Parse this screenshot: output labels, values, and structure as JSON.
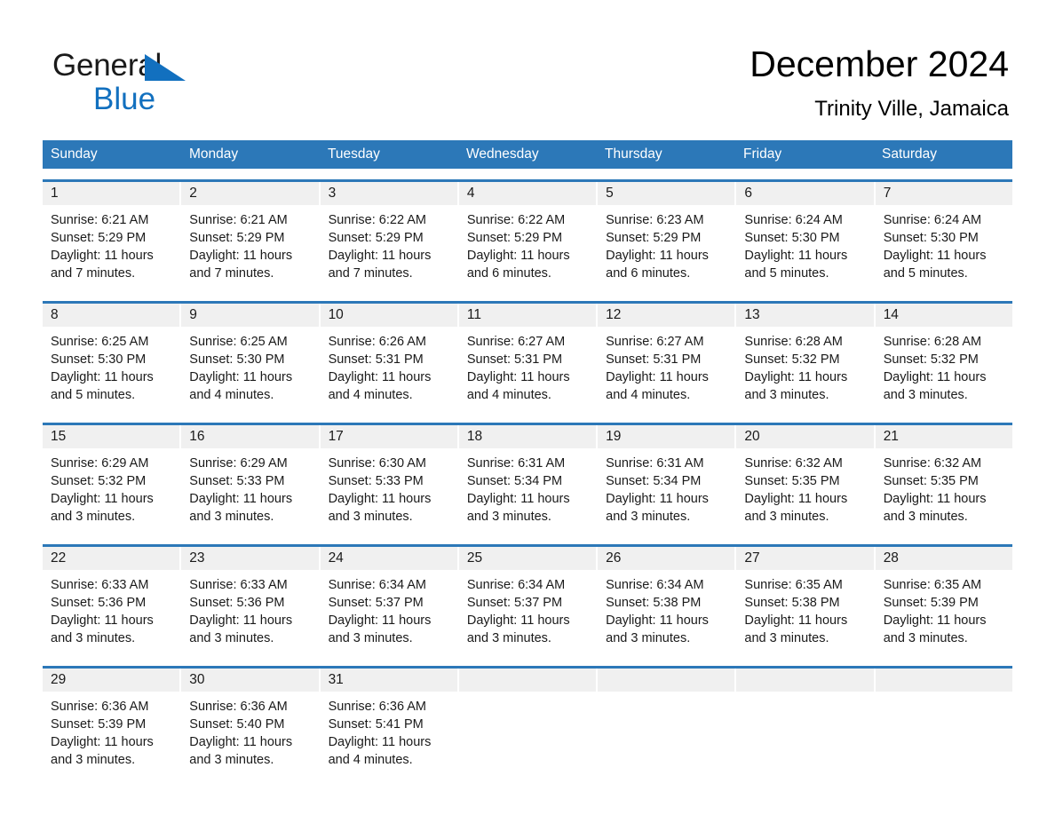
{
  "brand": {
    "name_part1": "General",
    "name_part2": "Blue",
    "flag_icon": "triangle-flag-icon",
    "accent_color": "#1270bf"
  },
  "header": {
    "title": "December 2024",
    "subtitle": "Trinity Ville, Jamaica"
  },
  "theme": {
    "header_blue": "#2c78b8",
    "day_band_gray": "#f0f0f0",
    "text_black": "#1a1a1a"
  },
  "weekdays": [
    "Sunday",
    "Monday",
    "Tuesday",
    "Wednesday",
    "Thursday",
    "Friday",
    "Saturday"
  ],
  "weeks": [
    [
      {
        "day": "1",
        "sunrise": "Sunrise: 6:21 AM",
        "sunset": "Sunset: 5:29 PM",
        "daylight": "Daylight: 11 hours and 7 minutes."
      },
      {
        "day": "2",
        "sunrise": "Sunrise: 6:21 AM",
        "sunset": "Sunset: 5:29 PM",
        "daylight": "Daylight: 11 hours and 7 minutes."
      },
      {
        "day": "3",
        "sunrise": "Sunrise: 6:22 AM",
        "sunset": "Sunset: 5:29 PM",
        "daylight": "Daylight: 11 hours and 7 minutes."
      },
      {
        "day": "4",
        "sunrise": "Sunrise: 6:22 AM",
        "sunset": "Sunset: 5:29 PM",
        "daylight": "Daylight: 11 hours and 6 minutes."
      },
      {
        "day": "5",
        "sunrise": "Sunrise: 6:23 AM",
        "sunset": "Sunset: 5:29 PM",
        "daylight": "Daylight: 11 hours and 6 minutes."
      },
      {
        "day": "6",
        "sunrise": "Sunrise: 6:24 AM",
        "sunset": "Sunset: 5:30 PM",
        "daylight": "Daylight: 11 hours and 5 minutes."
      },
      {
        "day": "7",
        "sunrise": "Sunrise: 6:24 AM",
        "sunset": "Sunset: 5:30 PM",
        "daylight": "Daylight: 11 hours and 5 minutes."
      }
    ],
    [
      {
        "day": "8",
        "sunrise": "Sunrise: 6:25 AM",
        "sunset": "Sunset: 5:30 PM",
        "daylight": "Daylight: 11 hours and 5 minutes."
      },
      {
        "day": "9",
        "sunrise": "Sunrise: 6:25 AM",
        "sunset": "Sunset: 5:30 PM",
        "daylight": "Daylight: 11 hours and 4 minutes."
      },
      {
        "day": "10",
        "sunrise": "Sunrise: 6:26 AM",
        "sunset": "Sunset: 5:31 PM",
        "daylight": "Daylight: 11 hours and 4 minutes."
      },
      {
        "day": "11",
        "sunrise": "Sunrise: 6:27 AM",
        "sunset": "Sunset: 5:31 PM",
        "daylight": "Daylight: 11 hours and 4 minutes."
      },
      {
        "day": "12",
        "sunrise": "Sunrise: 6:27 AM",
        "sunset": "Sunset: 5:31 PM",
        "daylight": "Daylight: 11 hours and 4 minutes."
      },
      {
        "day": "13",
        "sunrise": "Sunrise: 6:28 AM",
        "sunset": "Sunset: 5:32 PM",
        "daylight": "Daylight: 11 hours and 3 minutes."
      },
      {
        "day": "14",
        "sunrise": "Sunrise: 6:28 AM",
        "sunset": "Sunset: 5:32 PM",
        "daylight": "Daylight: 11 hours and 3 minutes."
      }
    ],
    [
      {
        "day": "15",
        "sunrise": "Sunrise: 6:29 AM",
        "sunset": "Sunset: 5:32 PM",
        "daylight": "Daylight: 11 hours and 3 minutes."
      },
      {
        "day": "16",
        "sunrise": "Sunrise: 6:29 AM",
        "sunset": "Sunset: 5:33 PM",
        "daylight": "Daylight: 11 hours and 3 minutes."
      },
      {
        "day": "17",
        "sunrise": "Sunrise: 6:30 AM",
        "sunset": "Sunset: 5:33 PM",
        "daylight": "Daylight: 11 hours and 3 minutes."
      },
      {
        "day": "18",
        "sunrise": "Sunrise: 6:31 AM",
        "sunset": "Sunset: 5:34 PM",
        "daylight": "Daylight: 11 hours and 3 minutes."
      },
      {
        "day": "19",
        "sunrise": "Sunrise: 6:31 AM",
        "sunset": "Sunset: 5:34 PM",
        "daylight": "Daylight: 11 hours and 3 minutes."
      },
      {
        "day": "20",
        "sunrise": "Sunrise: 6:32 AM",
        "sunset": "Sunset: 5:35 PM",
        "daylight": "Daylight: 11 hours and 3 minutes."
      },
      {
        "day": "21",
        "sunrise": "Sunrise: 6:32 AM",
        "sunset": "Sunset: 5:35 PM",
        "daylight": "Daylight: 11 hours and 3 minutes."
      }
    ],
    [
      {
        "day": "22",
        "sunrise": "Sunrise: 6:33 AM",
        "sunset": "Sunset: 5:36 PM",
        "daylight": "Daylight: 11 hours and 3 minutes."
      },
      {
        "day": "23",
        "sunrise": "Sunrise: 6:33 AM",
        "sunset": "Sunset: 5:36 PM",
        "daylight": "Daylight: 11 hours and 3 minutes."
      },
      {
        "day": "24",
        "sunrise": "Sunrise: 6:34 AM",
        "sunset": "Sunset: 5:37 PM",
        "daylight": "Daylight: 11 hours and 3 minutes."
      },
      {
        "day": "25",
        "sunrise": "Sunrise: 6:34 AM",
        "sunset": "Sunset: 5:37 PM",
        "daylight": "Daylight: 11 hours and 3 minutes."
      },
      {
        "day": "26",
        "sunrise": "Sunrise: 6:34 AM",
        "sunset": "Sunset: 5:38 PM",
        "daylight": "Daylight: 11 hours and 3 minutes."
      },
      {
        "day": "27",
        "sunrise": "Sunrise: 6:35 AM",
        "sunset": "Sunset: 5:38 PM",
        "daylight": "Daylight: 11 hours and 3 minutes."
      },
      {
        "day": "28",
        "sunrise": "Sunrise: 6:35 AM",
        "sunset": "Sunset: 5:39 PM",
        "daylight": "Daylight: 11 hours and 3 minutes."
      }
    ],
    [
      {
        "day": "29",
        "sunrise": "Sunrise: 6:36 AM",
        "sunset": "Sunset: 5:39 PM",
        "daylight": "Daylight: 11 hours and 3 minutes."
      },
      {
        "day": "30",
        "sunrise": "Sunrise: 6:36 AM",
        "sunset": "Sunset: 5:40 PM",
        "daylight": "Daylight: 11 hours and 3 minutes."
      },
      {
        "day": "31",
        "sunrise": "Sunrise: 6:36 AM",
        "sunset": "Sunset: 5:41 PM",
        "daylight": "Daylight: 11 hours and 4 minutes."
      },
      {
        "day": "",
        "sunrise": "",
        "sunset": "",
        "daylight": ""
      },
      {
        "day": "",
        "sunrise": "",
        "sunset": "",
        "daylight": ""
      },
      {
        "day": "",
        "sunrise": "",
        "sunset": "",
        "daylight": ""
      },
      {
        "day": "",
        "sunrise": "",
        "sunset": "",
        "daylight": ""
      }
    ]
  ]
}
